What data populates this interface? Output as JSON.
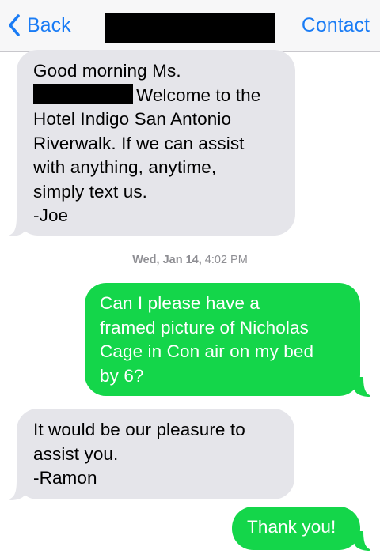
{
  "nav": {
    "back_label": "Back",
    "contact_label": "Contact"
  },
  "messages": [
    {
      "direction": "incoming",
      "lines": [
        "Good morning Ms.",
        "Welcome to the",
        "Hotel Indigo San Antonio",
        "Riverwalk. If we can assist",
        "with anything, anytime,",
        "simply text us.",
        "-Joe"
      ]
    },
    {
      "direction": "outgoing",
      "lines": [
        "Can I please have a",
        "framed picture of Nicholas",
        "Cage in Con air on my bed",
        "by 6?"
      ]
    },
    {
      "direction": "incoming",
      "lines": [
        "It would be our pleasure to",
        "assist you.",
        "-Ramon"
      ]
    },
    {
      "direction": "outgoing",
      "lines": [
        "Thank you!"
      ]
    }
  ],
  "timestamp": {
    "day": "Wed, Jan 14,",
    "time": "4:02 PM"
  },
  "colors": {
    "incoming_bubble": "#e5e5ea",
    "outgoing_bubble": "#14d64a",
    "accent": "#1a7cf5",
    "timestamp_text": "#8e8e93"
  },
  "icons": {
    "back": "chevron-left-icon"
  }
}
